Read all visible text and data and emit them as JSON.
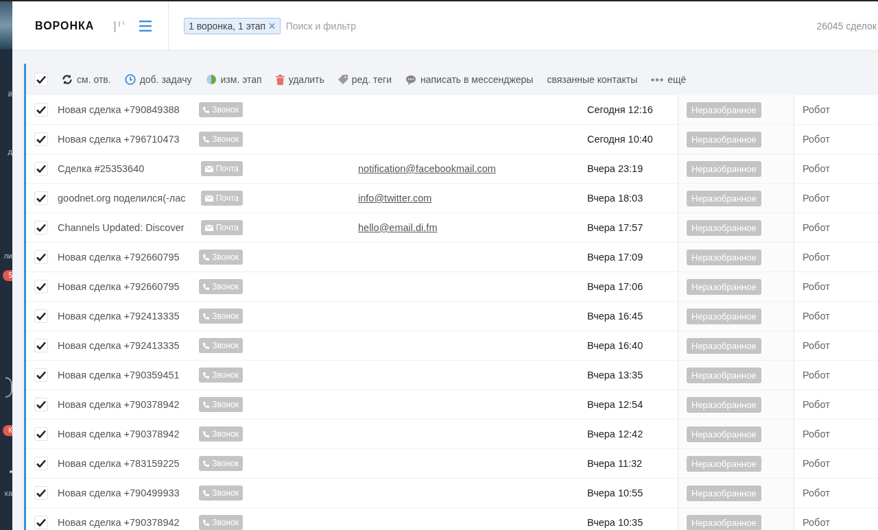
{
  "sidebar": {
    "items": [
      {
        "kind": "label",
        "text": "й"
      },
      {
        "kind": "label",
        "text": "д"
      },
      {
        "kind": "label",
        "text": "ли"
      },
      {
        "kind": "badge",
        "text": "5"
      },
      {
        "kind": "ring"
      },
      {
        "kind": "badge",
        "text": "К"
      },
      {
        "kind": "dot"
      },
      {
        "kind": "label",
        "text": "ка"
      }
    ]
  },
  "header": {
    "title": "ВОРОНКА",
    "views": [
      {
        "kind": "pipeline",
        "selected": false
      },
      {
        "kind": "list",
        "selected": true
      }
    ],
    "filter_chip": "1 воронка, 1 этап",
    "close": "×",
    "search": {
      "placeholder": "Поиск и фильтр"
    },
    "count": "26045 сделок"
  },
  "toolbar": {
    "select_all": {
      "checked": true
    },
    "actions": [
      {
        "kind": "refresh",
        "label": "см. отв."
      },
      {
        "kind": "clock",
        "label": "доб. задачу"
      },
      {
        "kind": "stage",
        "label": "изм. этап"
      },
      {
        "kind": "trash",
        "label": "удалить"
      },
      {
        "kind": "tag",
        "label": "ред. теги"
      },
      {
        "kind": "chat",
        "label": "написать в мессенджеры"
      },
      {
        "kind": "none",
        "label": "связанные контакты"
      },
      {
        "kind": "more",
        "label": "ещё"
      }
    ]
  },
  "rows": [
    {
      "checked": true,
      "name": "Новая сделка +790849388",
      "source": {
        "kind": "call",
        "label": "Звонок"
      },
      "date": "Сегодня 12:16",
      "status": "Неразобранное",
      "owner": "Робот"
    },
    {
      "checked": true,
      "name": "Новая сделка +796710473",
      "source": {
        "kind": "call",
        "label": "Звонок"
      },
      "date": "Сегодня 10:40",
      "status": "Неразобранное",
      "owner": "Робот"
    },
    {
      "checked": true,
      "name": "Сделка #25353640",
      "source": {
        "kind": "mail",
        "label": "Почта"
      },
      "email": "notification@facebookmail.com",
      "date": "Вчера 23:19",
      "status": "Неразобранное",
      "owner": "Робот"
    },
    {
      "checked": true,
      "name": "goodnet.org поделился(-лас",
      "source": {
        "kind": "mail",
        "label": "Почта"
      },
      "email": "info@twitter.com",
      "date": "Вчера 18:03",
      "status": "Неразобранное",
      "owner": "Робот"
    },
    {
      "checked": true,
      "name": "Channels Updated: Discover",
      "source": {
        "kind": "mail",
        "label": "Почта"
      },
      "email": "hello@email.di.fm",
      "date": "Вчера 17:57",
      "status": "Неразобранное",
      "owner": "Робот"
    },
    {
      "checked": true,
      "name": "Новая сделка +792660795",
      "source": {
        "kind": "call",
        "label": "Звонок"
      },
      "date": "Вчера 17:09",
      "status": "Неразобранное",
      "owner": "Робот"
    },
    {
      "checked": true,
      "name": "Новая сделка +792660795",
      "source": {
        "kind": "call",
        "label": "Звонок"
      },
      "date": "Вчера 17:06",
      "status": "Неразобранное",
      "owner": "Робот"
    },
    {
      "checked": true,
      "name": "Новая сделка +792413335",
      "source": {
        "kind": "call",
        "label": "Звонок"
      },
      "date": "Вчера 16:45",
      "status": "Неразобранное",
      "owner": "Робот"
    },
    {
      "checked": true,
      "name": "Новая сделка +792413335",
      "source": {
        "kind": "call",
        "label": "Звонок"
      },
      "date": "Вчера 16:40",
      "status": "Неразобранное",
      "owner": "Робот"
    },
    {
      "checked": true,
      "name": "Новая сделка +790359451",
      "source": {
        "kind": "call",
        "label": "Звонок"
      },
      "date": "Вчера 13:35",
      "status": "Неразобранное",
      "owner": "Робот"
    },
    {
      "checked": true,
      "name": "Новая сделка +790378942",
      "source": {
        "kind": "call",
        "label": "Звонок"
      },
      "date": "Вчера 12:54",
      "status": "Неразобранное",
      "owner": "Робот"
    },
    {
      "checked": true,
      "name": "Новая сделка +790378942",
      "source": {
        "kind": "call",
        "label": "Звонок"
      },
      "date": "Вчера 12:42",
      "status": "Неразобранное",
      "owner": "Робот"
    },
    {
      "checked": true,
      "name": "Новая сделка +783159225",
      "source": {
        "kind": "call",
        "label": "Звонок"
      },
      "date": "Вчера 11:32",
      "status": "Неразобранное",
      "owner": "Робот"
    },
    {
      "checked": true,
      "name": "Новая сделка +790499933",
      "source": {
        "kind": "call",
        "label": "Звонок"
      },
      "date": "Вчера 10:55",
      "status": "Неразобранное",
      "owner": "Робот"
    },
    {
      "checked": true,
      "name": "Новая сделка +790378942",
      "source": {
        "kind": "call",
        "label": "Звонок"
      },
      "date": "Вчера 10:35",
      "status": "Неразобранное",
      "owner": "Робот"
    }
  ]
}
